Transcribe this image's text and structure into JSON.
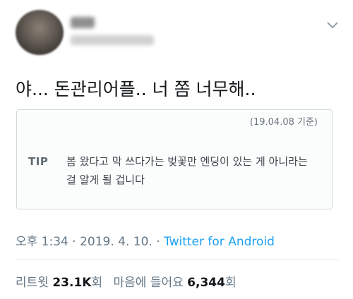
{
  "tweet": {
    "text": "야... 돈관리어플.. 너 쫌 너무해..",
    "card": {
      "date": "(19.04.08 기준)",
      "tip_label": "TIP",
      "body": "봄 왔다고 막 쓰다가는 벚꽃만 엔딩이 있는 게 아니라는 걸 알게 될 겁니다"
    },
    "meta": {
      "time": "오후 1:34",
      "sep1": " · ",
      "date": "2019. 4. 10.",
      "sep2": " · ",
      "source": "Twitter for Android"
    },
    "stats": {
      "retweets_label": "리트윗",
      "retweets_count": "23.1K",
      "retweets_unit": "회",
      "likes_label": "마음에 들어요",
      "likes_count": "6,344",
      "likes_unit": "회"
    }
  },
  "icons": {
    "menu": "chevron-down-icon"
  },
  "colors": {
    "link": "#1da1f2",
    "meta": "#657786",
    "text": "#14171a"
  }
}
